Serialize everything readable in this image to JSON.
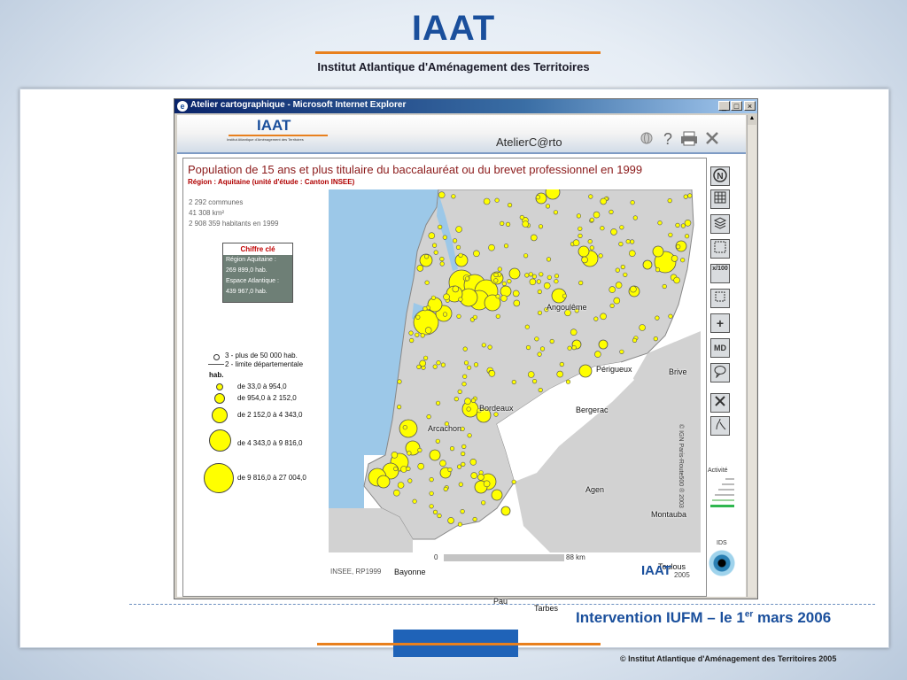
{
  "slide": {
    "logo": "IAAT",
    "subtitle": "Institut Atlantique d'Aménagement des Territoires",
    "footer_text_main": "Intervention IUFM – le 1",
    "footer_text_sup": "er",
    "footer_text_end": " mars 2006",
    "copyright": "© Institut Atlantique d'Aménagement des Territoires 2005"
  },
  "window": {
    "title": "Atelier cartographique - Microsoft Internet Explorer",
    "minimize": "_",
    "maximize": "□",
    "close": "×"
  },
  "app": {
    "logo": "IAAT",
    "logo_sub": "Institut Atlantique d'Aménagement des Territoires",
    "name": "AtelierC@rto",
    "toolbar_icons": [
      "globe-icon",
      "help-icon",
      "print-icon",
      "close-icon"
    ]
  },
  "map": {
    "title": "Population de 15 ans et plus titulaire du baccalauréat ou du brevet professionnel en 1999",
    "subtitle": "Région : Aquitaine (unité d'étude : Canton INSEE)",
    "stats": [
      "2 292 communes",
      "41 308 km²",
      "2 908 359 habitants en 1999"
    ],
    "key_figure": {
      "heading": "Chiffre clé",
      "lines": [
        "Région Aquitaine :",
        "269 899,0 hab.",
        "Espace Atlantique :",
        "439 967,0 hab."
      ]
    },
    "legend_lines": [
      "3 - plus de 50 000 hab.",
      "2 - limite départementale"
    ],
    "legend_unit": "hab.",
    "legend_classes": [
      "de 33,0 à 954,0",
      "de 954,0 à 2 152,0",
      "de 2 152,0 à 4 343,0",
      "de 4 343,0 à 9 816,0",
      "de 9 816,0 à 27 004,0"
    ],
    "cities": [
      "Angoulême",
      "Périgueux",
      "Brive",
      "Bordeaux",
      "Bergerac",
      "Arcachon",
      "Agen",
      "Montauba",
      "Bayonne",
      "Toulous",
      "Pau",
      "Tarbes"
    ],
    "vertical_credit": "© IGN Paris-Route500 ® 2003",
    "scale_start": "0",
    "scale_end": "88 km",
    "source": "INSEE, RP1999",
    "footer_logo": "IAAT",
    "footer_year": "2005",
    "colors": {
      "sea": "#9cc8e8",
      "land_region": "#d2d2d2",
      "land_outside": "#ffffff",
      "symbol": "#ffff00"
    }
  },
  "tools": {
    "labels": [
      "",
      "",
      "",
      "",
      "x/100",
      "",
      "+",
      "MD",
      "",
      "",
      ""
    ],
    "icons": [
      "north-arrow-icon",
      "grid-icon",
      "layers-icon",
      "frame-icon",
      "scale-icon",
      "select-icon",
      "zoom-in-icon",
      "md-icon",
      "comment-icon",
      "delete-icon",
      "curve-icon"
    ],
    "activity_label": "Activité",
    "ids_label": "IDS"
  }
}
